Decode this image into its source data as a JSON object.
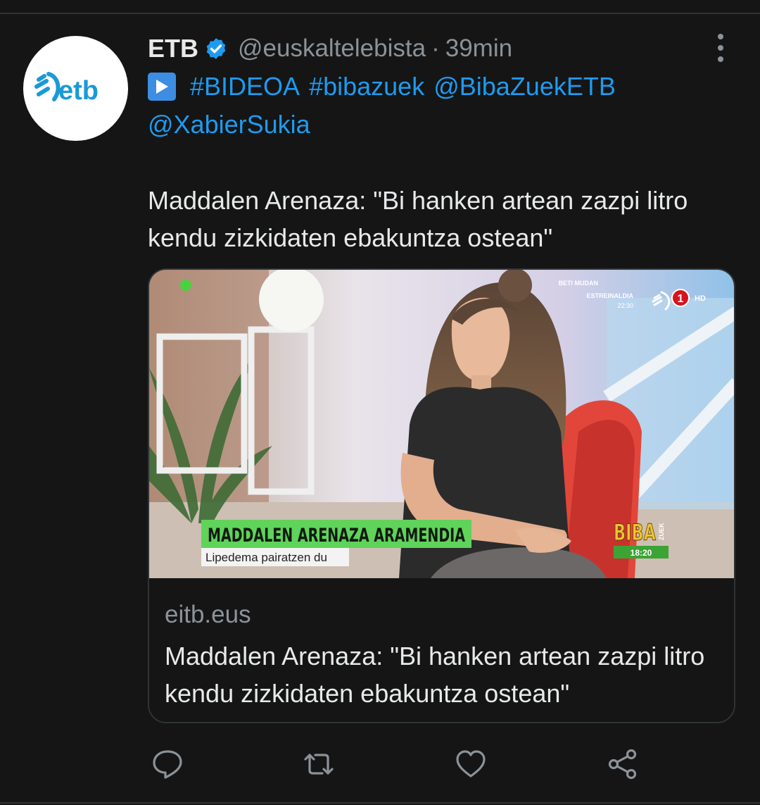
{
  "tweet": {
    "author_name": "ETB",
    "author_handle": "@euskaltelebista",
    "separator": "·",
    "time": "39min",
    "avatar_logo_text": "etb",
    "hashtags_line1": [
      "#BIDEOA",
      "#bibazuek",
      "@BibaZuekETB"
    ],
    "mention_line2": "@XabierSukia",
    "text": "Maddalen Arenaza: \"Bi hanken artean zazpi litro kendu zizkidaten ebakuntza ostean\""
  },
  "card": {
    "domain": "eitb.eus",
    "title": "Maddalen Arenaza: \"Bi hanken artean zazpi litro kendu zizkidaten ebakuntza ostean\"",
    "media": {
      "lower_third_name": "MADDALEN ARENAZA ARAMENDIA",
      "lower_third_subtitle": "Lipedema pairatzen du",
      "promo_line1": "BETI MUDAN",
      "promo_line2": "ESTREINALDIA",
      "promo_time": "22:30",
      "channel_number": "1",
      "channel_hd": "HD",
      "show_logo": "BIBA",
      "show_logo_small": "ZUEK",
      "show_clock": "18:20"
    }
  },
  "icons": {
    "verified": "verified-badge-icon",
    "more": "more-options-icon",
    "play": "play-button-icon",
    "reply": "reply-icon",
    "retweet": "retweet-icon",
    "like": "like-icon",
    "share": "share-icon"
  },
  "colors": {
    "background": "#151515",
    "link": "#1d9bf0",
    "muted_text": "#8b9299",
    "etb_blue": "#1a9ad6",
    "lower_third_green": "#5fd35a"
  }
}
